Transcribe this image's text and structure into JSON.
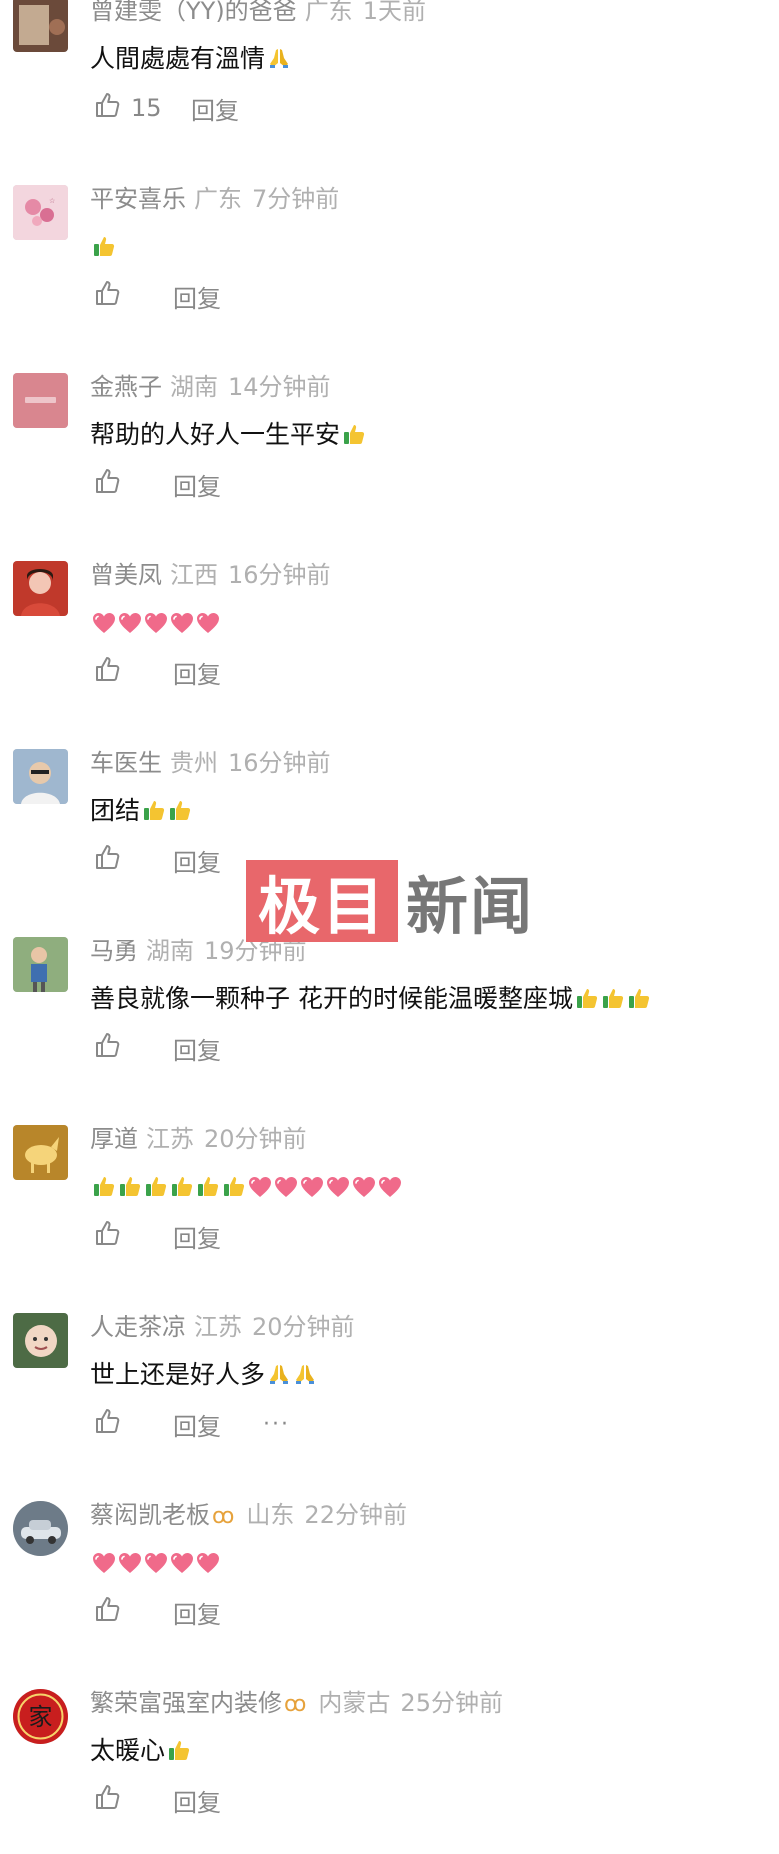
{
  "comments": [
    {
      "user": "曾建雯（YY)的爸爸",
      "location": "广东",
      "time": "1天前",
      "text": "人間處處有溫情",
      "emojis": [
        "pray"
      ],
      "likes": "15",
      "reply": "回复",
      "badge": ""
    },
    {
      "user": "平安喜乐",
      "location": "广东",
      "time": "7分钟前",
      "text": "",
      "emojis": [
        "thumb"
      ],
      "likes": "",
      "reply": "回复",
      "badge": ""
    },
    {
      "user": "金燕子",
      "location": "湖南",
      "time": "14分钟前",
      "text": "帮助的人好人一生平安",
      "emojis": [
        "thumb"
      ],
      "likes": "",
      "reply": "回复",
      "badge": ""
    },
    {
      "user": "曾美凤",
      "location": "江西",
      "time": "16分钟前",
      "text": "",
      "emojis": [
        "heart",
        "heart",
        "heart",
        "heart",
        "heart"
      ],
      "likes": "",
      "reply": "回复",
      "badge": ""
    },
    {
      "user": "车医生",
      "location": "贵州",
      "time": "16分钟前",
      "text": "团结",
      "emojis": [
        "thumb",
        "thumb"
      ],
      "likes": "",
      "reply": "回复",
      "badge": ""
    },
    {
      "user": "马勇",
      "location": "湖南",
      "time": "19分钟前",
      "text": "善良就像一颗种子 花开的时候能温暖整座城",
      "emojis": [
        "thumb",
        "thumb",
        "thumb"
      ],
      "likes": "",
      "reply": "回复",
      "badge": ""
    },
    {
      "user": "厚道",
      "location": "江苏",
      "time": "20分钟前",
      "text": "",
      "emojis": [
        "thumb",
        "thumb",
        "thumb",
        "thumb",
        "thumb",
        "thumb",
        "heart",
        "heart",
        "heart",
        "heart",
        "heart",
        "heart"
      ],
      "likes": "",
      "reply": "回复",
      "badge": ""
    },
    {
      "user": "人走茶凉",
      "location": "江苏",
      "time": "20分钟前",
      "text": "世上还是好人多",
      "emojis": [
        "pray",
        "pray"
      ],
      "likes": "",
      "reply": "回复",
      "badge": "",
      "more": "···"
    },
    {
      "user": "蔡闳凯老板",
      "location": "山东",
      "time": "22分钟前",
      "text": "",
      "emojis": [
        "heart",
        "heart",
        "heart",
        "heart",
        "heart"
      ],
      "likes": "",
      "reply": "回复",
      "badge": "ꝏ"
    },
    {
      "user": "繁荣富强室内装修",
      "location": "内蒙古",
      "time": "25分钟前",
      "text": "太暖心",
      "emojis": [
        "thumb"
      ],
      "likes": "",
      "reply": "回复",
      "badge": "ꝏ"
    }
  ],
  "avatars": [
    {
      "icon": "avatar-photo-icon",
      "bg": "#6b4a3a",
      "fg": "#d9c2a8",
      "shape": "square"
    },
    {
      "icon": "flower-avatar-icon",
      "bg": "#f3d6de",
      "fg": "#e58aa6",
      "shape": "square"
    },
    {
      "icon": "pink-card-avatar-icon",
      "bg": "#d9868f",
      "fg": "#f7dfe2",
      "shape": "square"
    },
    {
      "icon": "woman-avatar-icon",
      "bg": "#c0392b",
      "fg": "#f3c6b5",
      "shape": "square"
    },
    {
      "icon": "man-glasses-avatar-icon",
      "bg": "#9fb7cf",
      "fg": "#e7c9ab",
      "shape": "square"
    },
    {
      "icon": "child-avatar-icon",
      "bg": "#8fae7e",
      "fg": "#e6e6e6",
      "shape": "square"
    },
    {
      "icon": "golden-horse-avatar-icon",
      "bg": "#b8862a",
      "fg": "#f5d47a",
      "shape": "square"
    },
    {
      "icon": "baby-avatar-icon",
      "bg": "#4d6b45",
      "fg": "#f1d7c4",
      "shape": "square"
    },
    {
      "icon": "car-avatar-icon",
      "bg": "#6d7b88",
      "fg": "#dfe5ea",
      "shape": "round"
    },
    {
      "icon": "family-seal-avatar-icon",
      "bg": "#c81e1e",
      "fg": "#f6d36a",
      "shape": "round",
      "seal_char": "家"
    }
  ],
  "watermark": {
    "box": "极目",
    "text": "新闻"
  },
  "colors": {
    "heart": "#f06a8a",
    "thumb": "#f4c431",
    "accent_badge": "#e6a23c"
  }
}
